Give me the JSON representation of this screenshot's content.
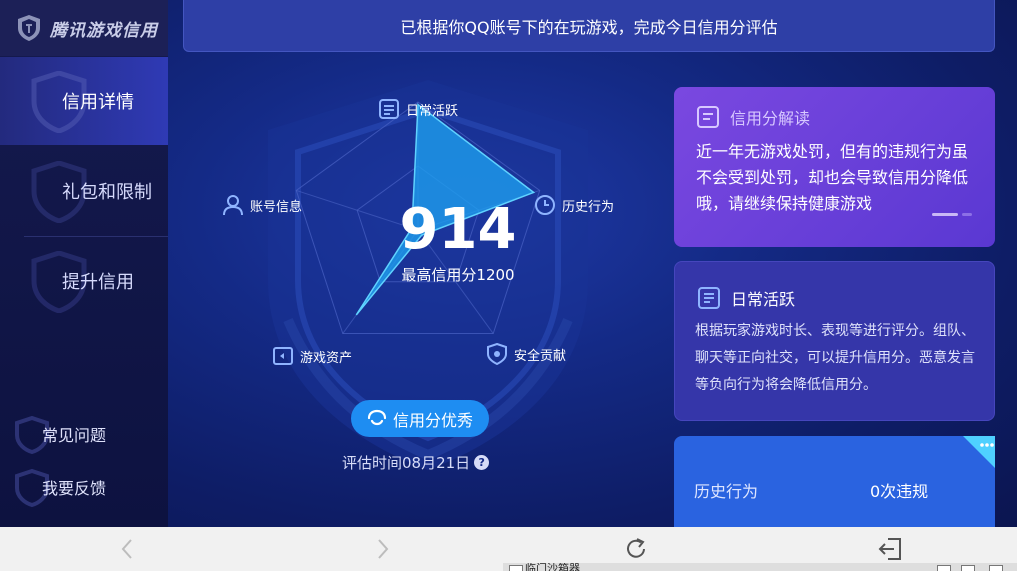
{
  "brand": {
    "name": "腾讯游戏信用"
  },
  "sidebar": {
    "items": [
      {
        "label": "信用详情",
        "active": true
      },
      {
        "label": "礼包和限制",
        "active": false
      },
      {
        "label": "提升信用",
        "active": false
      }
    ],
    "footer": [
      {
        "label": "常见问题"
      },
      {
        "label": "我要反馈"
      }
    ]
  },
  "banner": {
    "text": "已根据你QQ账号下的在玩游戏，完成今日信用分评估"
  },
  "radar": {
    "axes": [
      "日常活跃",
      "历史行为",
      "安全贡献",
      "游戏资产",
      "账号信息"
    ],
    "levels": [
      0.98,
      0.95,
      0.05,
      0.82,
      0.05
    ]
  },
  "score": {
    "value": "914",
    "max_label": "最高信用分1200"
  },
  "rating_button": {
    "label": "信用分优秀"
  },
  "eval_time": {
    "text": "评估时间08月21日",
    "help": "?"
  },
  "cards": {
    "interpretation": {
      "title": "信用分解读",
      "body": "近一年无游戏处罚，但有的违规行为虽不会受到处罚，却也会导致信用分降低哦，请继续保持健康游戏"
    },
    "daily": {
      "title": "日常活跃",
      "body": "根据玩家游戏时长、表现等进行评分。组队、聊天等正向社交，可以提升信用分。恶意发言等负向行为将会降低信用分。"
    },
    "history": {
      "label": "历史行为",
      "value": "0次违规"
    }
  },
  "taskbar": {
    "title": "临门沙箱器"
  },
  "colors": {
    "accent": "#1e8df2",
    "radar_fill": "#1ea0f0",
    "interp_card": "#6a40da",
    "daily_card": "#3536a9",
    "history_card": "#2a63e0"
  }
}
